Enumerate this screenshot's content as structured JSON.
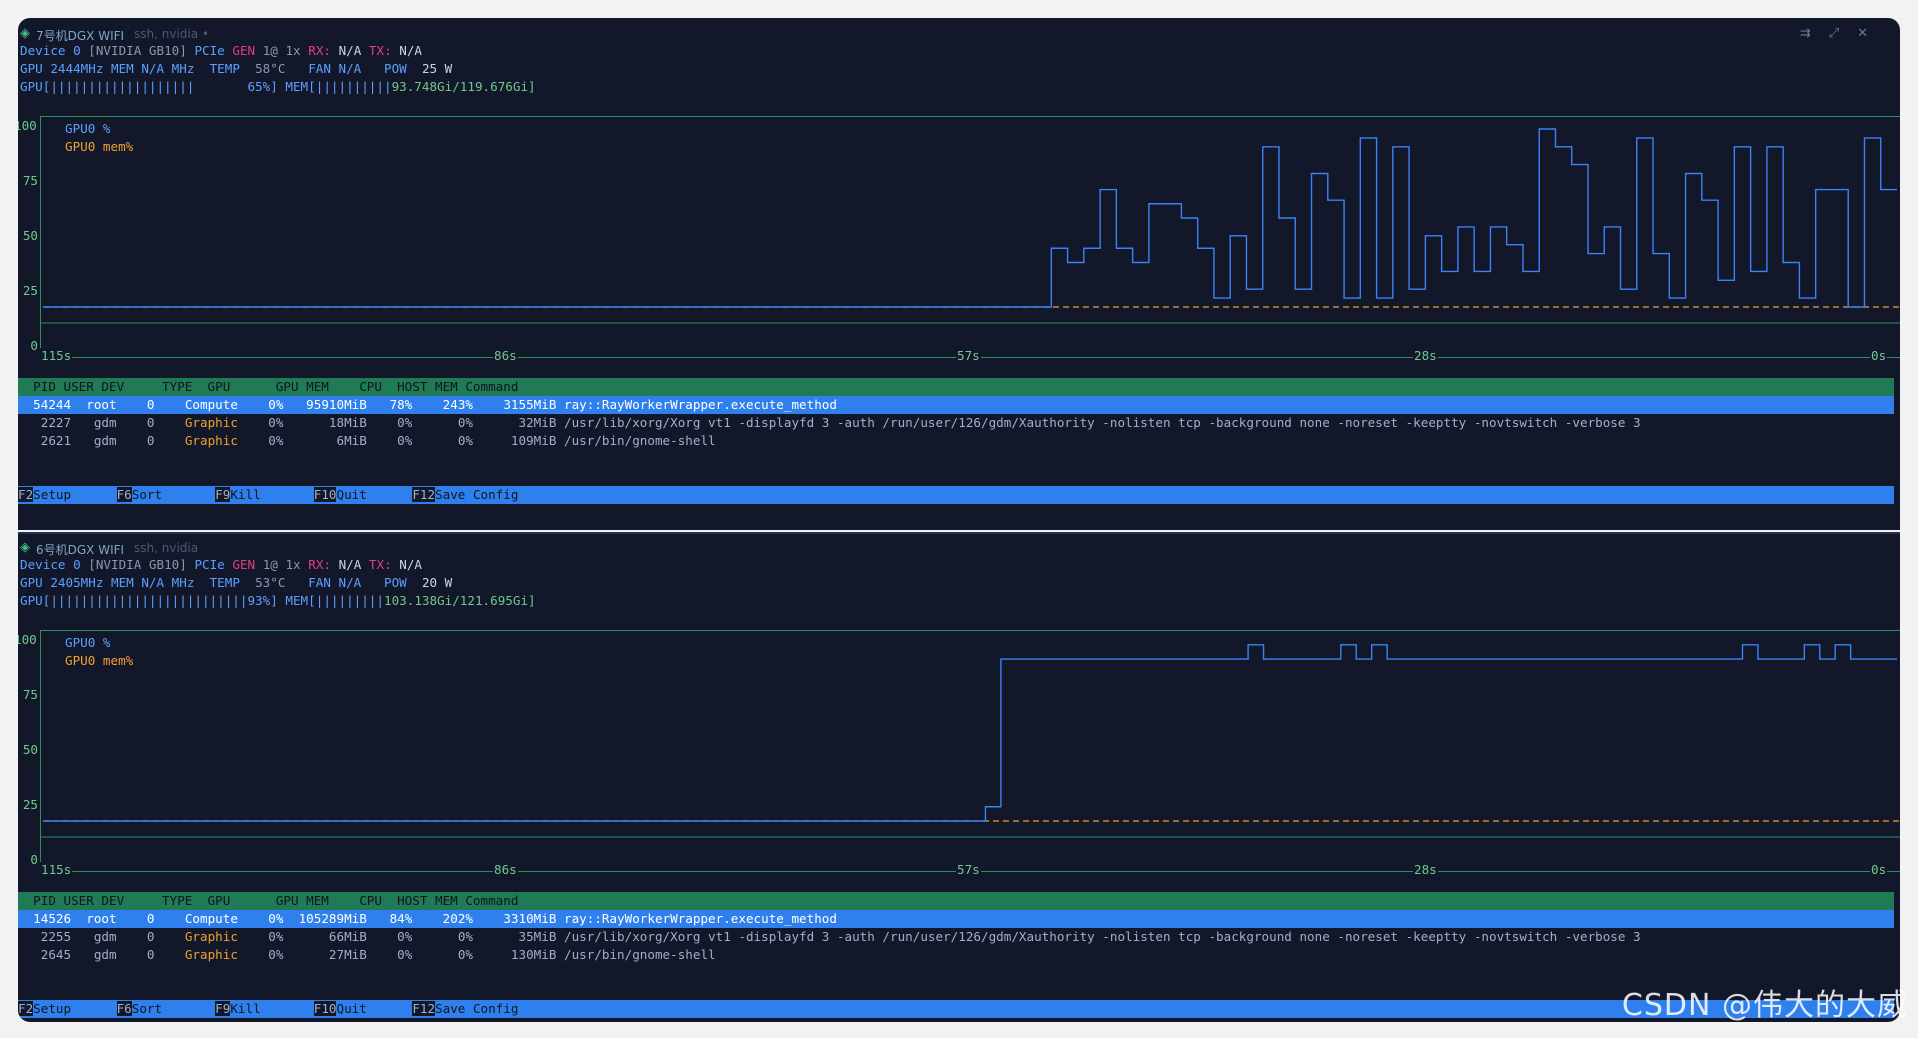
{
  "panes": [
    {
      "title": "7号机DGX WIFI",
      "subtitle": "ssh, nvidia",
      "dot": "•",
      "device_line": {
        "dev": "Device 0",
        "name": "[NVIDIA GB10]",
        "pcie": "PCIe",
        "gen_label": "GEN",
        "gen": "1@ 1x",
        "rx_label": "RX:",
        "rx": "N/A",
        "tx_label": "TX:",
        "tx": "N/A"
      },
      "stats_line": {
        "gpu": "GPU 2444MHz",
        "mem": "MEM N/A MHz",
        "temp_label": "TEMP",
        "temp": "58°C",
        "fan": "FAN N/A",
        "pow_label": "POW",
        "pow": "25 W"
      },
      "bars_line": {
        "gpu_bar": "GPU[|||||||||||||||||||       65%]",
        "mem_label": "MEM[",
        "mem_bar": "||||||||||",
        "mem_val": "93.748Gi/119.676Gi]"
      },
      "gpu_util_percent": 65,
      "mem_used_gi": 93.748,
      "mem_total_gi": 119.676,
      "graph": {
        "y_ticks": [
          "100",
          "75",
          "50",
          "25",
          "0"
        ],
        "x_ticks": [
          "115s",
          "86s",
          "57s",
          "28s",
          "0s"
        ],
        "legend": [
          "GPU0 %",
          "GPU0 mem%"
        ],
        "gpu_series": [
          0,
          0,
          0,
          0,
          0,
          0,
          0,
          0,
          0,
          0,
          0,
          0,
          0,
          0,
          0,
          0,
          0,
          0,
          0,
          0,
          0,
          0,
          0,
          0,
          0,
          0,
          0,
          0,
          0,
          0,
          0,
          0,
          0,
          0,
          0,
          0,
          0,
          0,
          0,
          0,
          0,
          0,
          0,
          0,
          0,
          0,
          0,
          0,
          0,
          0,
          0,
          0,
          0,
          0,
          0,
          0,
          0,
          0,
          0,
          0,
          0,
          0,
          33,
          25,
          33,
          66,
          33,
          25,
          58,
          58,
          50,
          33,
          5,
          40,
          10,
          90,
          50,
          10,
          75,
          60,
          5,
          95,
          5,
          90,
          10,
          40,
          20,
          45,
          20,
          45,
          35,
          20,
          100,
          90,
          80,
          30,
          45,
          10,
          95,
          30,
          5,
          75,
          60,
          15,
          90,
          20,
          90,
          25,
          5,
          66,
          66,
          0,
          95,
          66
        ],
        "mem_series_value": 0
      },
      "processes": {
        "header": "  PID USER DEV     TYPE  GPU      GPU MEM    CPU  HOST MEM Command",
        "rows": [
          {
            "pid": "54244",
            "user": "root",
            "dev": "0",
            "type": "Compute",
            "gpu": "0%",
            "gpumem": "95910MiB",
            "gpumemp": "78%",
            "cpu": "243%",
            "hostmem": "3155MiB",
            "cmd": "ray::RayWorkerWrapper.execute_method"
          },
          {
            "pid": "2227",
            "user": "gdm",
            "dev": "0",
            "type": "Graphic",
            "gpu": "0%",
            "gpumem": "18MiB",
            "gpumemp": "0%",
            "cpu": "0%",
            "hostmem": "32MiB",
            "cmd": "/usr/lib/xorg/Xorg vt1 -displayfd 3 -auth /run/user/126/gdm/Xauthority -nolisten tcp -background none -noreset -keeptty -novtswitch -verbose 3"
          },
          {
            "pid": "2621",
            "user": "gdm",
            "dev": "0",
            "type": "Graphic",
            "gpu": "0%",
            "gpumem": "6MiB",
            "gpumemp": "0%",
            "cpu": "0%",
            "hostmem": "109MiB",
            "cmd": "/usr/bin/gnome-shell"
          }
        ]
      }
    },
    {
      "title": "6号机DGX WIFI",
      "subtitle": "ssh, nvidia",
      "dot": "",
      "device_line": {
        "dev": "Device 0",
        "name": "[NVIDIA GB10]",
        "pcie": "PCIe",
        "gen_label": "GEN",
        "gen": "1@ 1x",
        "rx_label": "RX:",
        "rx": "N/A",
        "tx_label": "TX:",
        "tx": "N/A"
      },
      "stats_line": {
        "gpu": "GPU 2405MHz",
        "mem": "MEM N/A MHz",
        "temp_label": "TEMP",
        "temp": "53°C",
        "fan": "FAN N/A",
        "pow_label": "POW",
        "pow": "20 W"
      },
      "bars_line": {
        "gpu_bar": "GPU[||||||||||||||||||||||||||93%]",
        "mem_label": "MEM[",
        "mem_bar": "|||||||||",
        "mem_val": "103.138Gi/121.695Gi]"
      },
      "gpu_util_percent": 93,
      "mem_used_gi": 103.138,
      "mem_total_gi": 121.695,
      "graph": {
        "y_ticks": [
          "100",
          "75",
          "50",
          "25",
          "0"
        ],
        "x_ticks": [
          "115s",
          "86s",
          "57s",
          "28s",
          "0s"
        ],
        "legend": [
          "GPU0 %",
          "GPU0 mem%"
        ],
        "gpu_series": [
          0,
          0,
          0,
          0,
          0,
          0,
          0,
          0,
          0,
          0,
          0,
          0,
          0,
          0,
          0,
          0,
          0,
          0,
          0,
          0,
          0,
          0,
          0,
          0,
          0,
          0,
          0,
          0,
          0,
          0,
          0,
          0,
          0,
          0,
          0,
          0,
          0,
          0,
          0,
          0,
          0,
          0,
          0,
          0,
          0,
          0,
          0,
          0,
          0,
          0,
          0,
          0,
          0,
          0,
          0,
          0,
          0,
          0,
          0,
          0,
          0,
          8,
          91,
          91,
          91,
          91,
          91,
          91,
          91,
          91,
          91,
          91,
          91,
          91,
          91,
          91,
          91,
          91,
          99,
          91,
          91,
          91,
          91,
          91,
          99,
          91,
          99,
          91,
          91,
          91,
          91,
          91,
          91,
          91,
          91,
          91,
          91,
          91,
          91,
          91,
          91,
          91,
          91,
          91,
          91,
          91,
          91,
          91,
          91,
          91,
          99,
          91,
          91,
          91,
          99,
          91,
          99,
          91,
          91,
          91
        ],
        "mem_series_value": 0
      },
      "processes": {
        "header": "  PID USER DEV     TYPE  GPU      GPU MEM    CPU  HOST MEM Command",
        "rows": [
          {
            "pid": "14526",
            "user": "root",
            "dev": "0",
            "type": "Compute",
            "gpu": "0%",
            "gpumem": "105289MiB",
            "gpumemp": "84%",
            "cpu": "202%",
            "hostmem": "3310MiB",
            "cmd": "ray::RayWorkerWrapper.execute_method"
          },
          {
            "pid": "2255",
            "user": "gdm",
            "dev": "0",
            "type": "Graphic",
            "gpu": "0%",
            "gpumem": "66MiB",
            "gpumemp": "0%",
            "cpu": "0%",
            "hostmem": "35MiB",
            "cmd": "/usr/lib/xorg/Xorg vt1 -displayfd 3 -auth /run/user/126/gdm/Xauthority -nolisten tcp -background none -noreset -keeptty -novtswitch -verbose 3"
          },
          {
            "pid": "2645",
            "user": "gdm",
            "dev": "0",
            "type": "Graphic",
            "gpu": "0%",
            "gpumem": "27MiB",
            "gpumemp": "0%",
            "cpu": "0%",
            "hostmem": "130MiB",
            "cmd": "/usr/bin/gnome-shell"
          }
        ]
      }
    }
  ],
  "function_keys": [
    {
      "key": "F2",
      "label": "Setup"
    },
    {
      "key": "F6",
      "label": "Sort"
    },
    {
      "key": "F9",
      "label": "Kill"
    },
    {
      "key": "F10",
      "label": "Quit"
    },
    {
      "key": "F12",
      "label": "Save Config"
    }
  ],
  "window_buttons": [
    "⇉",
    "⤢",
    "✕"
  ],
  "watermark": "CSDN @伟大的大威",
  "colors": {
    "bg": "#13172a",
    "gpu_line": "#3b82f6",
    "mem_line": "#f0a030",
    "accent": "#2f80ed",
    "header_green": "#1f7a55"
  }
}
